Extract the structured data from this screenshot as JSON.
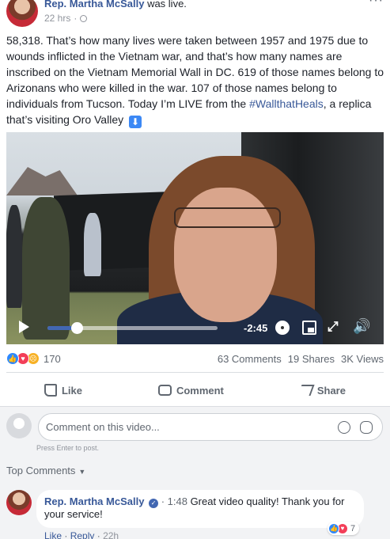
{
  "post": {
    "author": "Rep. Martha McSally",
    "action": "was live.",
    "time": "22 hrs",
    "meta_sep": "·",
    "more": "···",
    "text_main": "58,318. That’s how many lives were taken between 1957 and 1975 due to wounds inflicted in the Vietnam war, and that’s how many names are inscribed on the Vietnam Memorial Wall in DC. 619 of those names belong to Arizonans who were killed in the war. 107 of those names belong to individuals from Tucson. Today I’m LIVE from the",
    "hashtag": "#WallthatHeals",
    "text_end": ", a replica that’s visiting Oro Valley",
    "arrow": "⬇"
  },
  "video": {
    "time_remaining": "-2:45",
    "progress": 0.17,
    "icons": [
      "play-icon",
      "gear-icon",
      "pip-icon",
      "expand-icon",
      "volume-icon"
    ]
  },
  "stats": {
    "reaction_count": "170",
    "comments": "63 Comments",
    "shares": "19 Shares",
    "views": "3K Views"
  },
  "actions": {
    "like": "Like",
    "comment": "Comment",
    "share": "Share"
  },
  "comments": {
    "placeholder": "Comment on this video...",
    "press_enter": "Press Enter to post.",
    "sort_label": "Top Comments",
    "items": [
      {
        "author": "Rep. Martha McSally",
        "timestamp": "· 1:48",
        "text": "Great video quality! Thank you for your service!",
        "reaction_count": "7",
        "like": "Like",
        "reply": "Reply",
        "ago": "22h"
      }
    ]
  },
  "colors": {
    "link": "#385898",
    "like_reaction": "#2d88ff",
    "love_reaction": "#f33e58",
    "sad_reaction": "#f7b125"
  }
}
